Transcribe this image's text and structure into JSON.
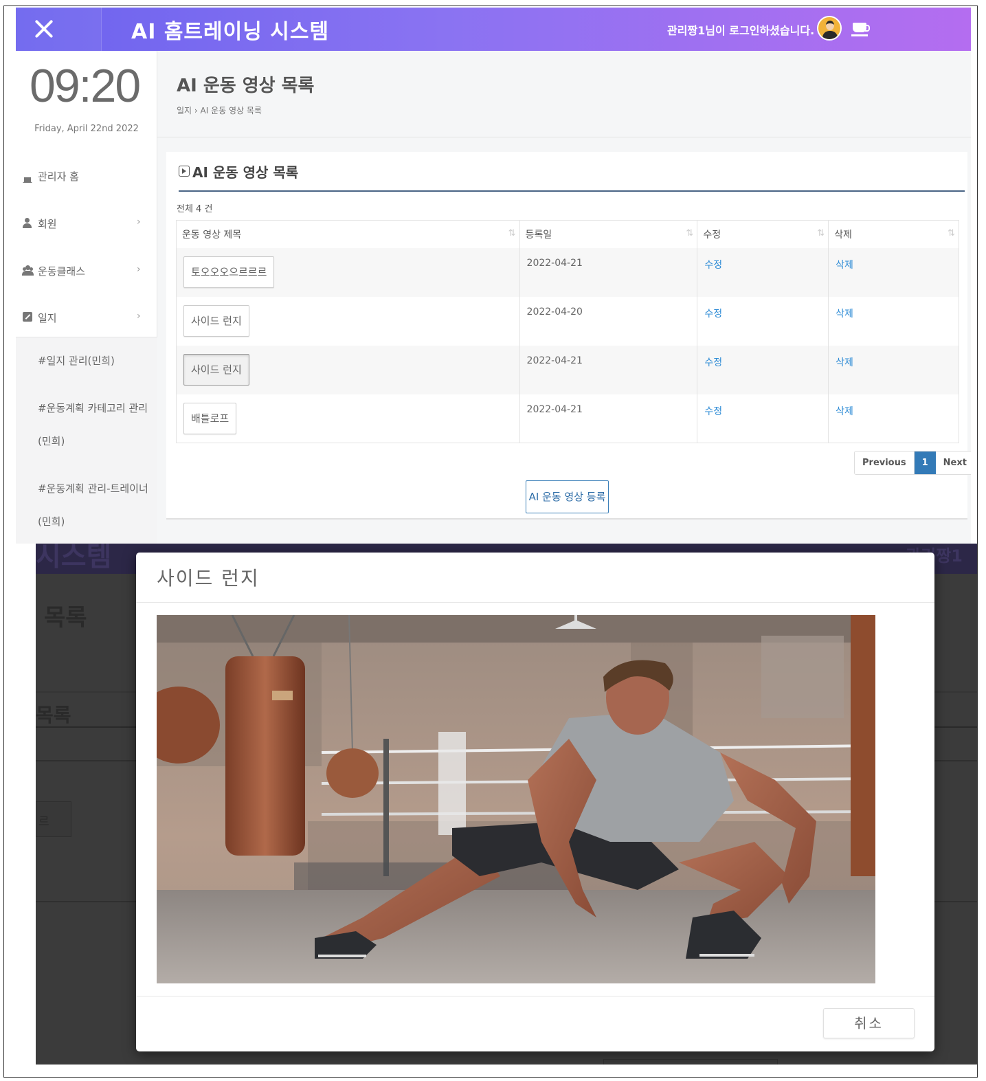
{
  "app": {
    "title": "AI 홈트레이닝 시스템",
    "login_message": "관리짱1님이 로그인하셨습니다."
  },
  "sidebar": {
    "clock": "09:20",
    "date": "Friday, April 22nd 2022",
    "items": [
      {
        "label": "관리자 홈",
        "icon": "home-icon"
      },
      {
        "label": "회원",
        "icon": "user-icon"
      },
      {
        "label": "운동클래스",
        "icon": "users-icon"
      },
      {
        "label": "일지",
        "icon": "edit-icon"
      }
    ],
    "subitems": [
      "#일지 관리(민희)",
      "#운동계획 카테고리 관리",
      "(민희)",
      "#운동계획 관리-트레이너",
      "(민희)"
    ],
    "chevron": "›"
  },
  "content": {
    "page_title": "AI 운동 영상 목록",
    "breadcrumb": "일지 › AI 운동 영상 목록",
    "panel_title": "AI 운동 영상 목록",
    "total_count": "전체 4 건",
    "columns": [
      "운동 영상 제목",
      "등록일",
      "수정",
      "삭제"
    ],
    "rows": [
      {
        "title": "토오오오으르르르",
        "date": "2022-04-21",
        "edit": "수정",
        "delete": "삭제"
      },
      {
        "title": "사이드 런지",
        "date": "2022-04-20",
        "edit": "수정",
        "delete": "삭제"
      },
      {
        "title": "사이드 런지",
        "date": "2022-04-21",
        "edit": "수정",
        "delete": "삭제"
      },
      {
        "title": "배틀로프",
        "date": "2022-04-21",
        "edit": "수정",
        "delete": "삭제"
      }
    ],
    "pagination": {
      "previous": "Previous",
      "current": "1",
      "next": "Next"
    },
    "register_button": "AI 운동 영상 등록"
  },
  "background_fragments": {
    "header": "시스템",
    "header_right": "관리짱1",
    "title": "목록",
    "panel": "목록",
    "cell": "르"
  },
  "modal": {
    "title": "사이드 런지",
    "cancel_button": "취소"
  },
  "colors": {
    "header_gradient_start": "#6c63ee",
    "header_gradient_end": "#b46df0",
    "link": "#2f8cd6",
    "pagination_active": "#337ab7",
    "overlay": "#3b3b3b"
  }
}
